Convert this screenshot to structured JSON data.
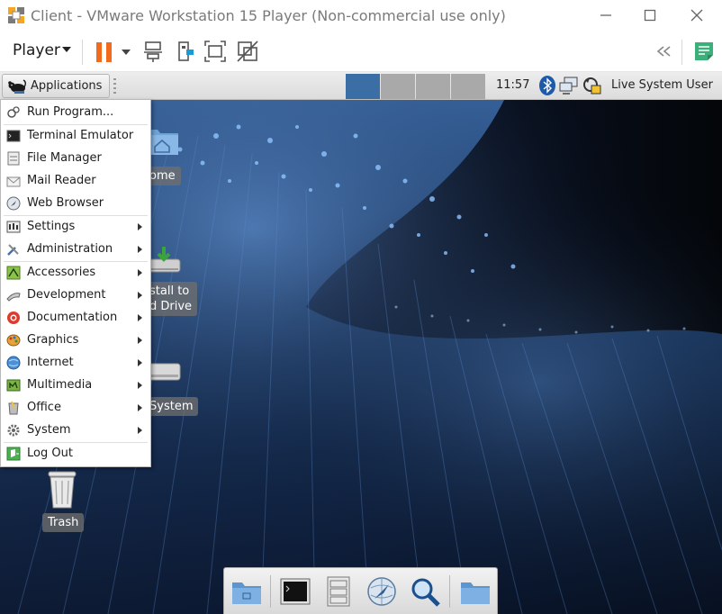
{
  "window": {
    "title": "Client - VMware Workstation 15 Player (Non-commercial use only)",
    "controls": [
      "minimize",
      "maximize",
      "close"
    ]
  },
  "toolbar": {
    "player_label": "Player",
    "icons": [
      "pause-icon",
      "send-ctrl-alt-del-icon",
      "removable-devices-icon",
      "fullscreen-icon",
      "unity-icon",
      "collapse-toolbar-icon",
      "notes-icon"
    ],
    "accent_color": "#f26b1d"
  },
  "panel": {
    "applications_label": "Applications",
    "workspaces": [
      {
        "active": true,
        "color": "#3b6ea5"
      },
      {
        "active": false,
        "color": "#a9a9a9"
      },
      {
        "active": false,
        "color": "#a9a9a9"
      },
      {
        "active": false,
        "color": "#a9a9a9"
      }
    ],
    "clock": "11:57",
    "tray_icons": [
      "bluetooth-icon",
      "network-icon",
      "updates-icon"
    ],
    "user": "Live System User"
  },
  "menu": {
    "items": [
      {
        "label": "Run Program...",
        "icon": "run-program-icon",
        "submenu": false
      },
      {
        "label": "Terminal Emulator",
        "icon": "terminal-icon",
        "submenu": false
      },
      {
        "label": "File Manager",
        "icon": "file-manager-icon",
        "submenu": false
      },
      {
        "label": "Mail Reader",
        "icon": "mail-icon",
        "submenu": false
      },
      {
        "label": "Web Browser",
        "icon": "web-browser-icon",
        "submenu": false
      },
      {
        "label": "Settings",
        "icon": "settings-icon",
        "submenu": true
      },
      {
        "label": "Administration",
        "icon": "administration-icon",
        "submenu": true
      },
      {
        "label": "Accessories",
        "icon": "accessories-icon",
        "submenu": true
      },
      {
        "label": "Development",
        "icon": "development-icon",
        "submenu": true
      },
      {
        "label": "Documentation",
        "icon": "documentation-icon",
        "submenu": true
      },
      {
        "label": "Graphics",
        "icon": "graphics-icon",
        "submenu": true
      },
      {
        "label": "Internet",
        "icon": "internet-icon",
        "submenu": true
      },
      {
        "label": "Multimedia",
        "icon": "multimedia-icon",
        "submenu": true
      },
      {
        "label": "Office",
        "icon": "office-icon",
        "submenu": true
      },
      {
        "label": "System",
        "icon": "system-icon",
        "submenu": true
      },
      {
        "label": "Log Out",
        "icon": "log-out-icon",
        "submenu": false
      }
    ]
  },
  "desktop": {
    "icons": [
      {
        "label": "ome",
        "icon": "home-folder-icon"
      },
      {
        "label_lines": [
          "stall to",
          "d Drive"
        ],
        "icon": "install-to-hard-drive-icon"
      },
      {
        "label": "System",
        "icon": "file-system-icon"
      },
      {
        "label": "Trash",
        "icon": "trash-icon"
      }
    ]
  },
  "dock": {
    "items": [
      "show-desktop-icon",
      "terminal-icon",
      "file-manager-icon",
      "web-browser-icon",
      "search-icon",
      "folder-icon"
    ]
  }
}
